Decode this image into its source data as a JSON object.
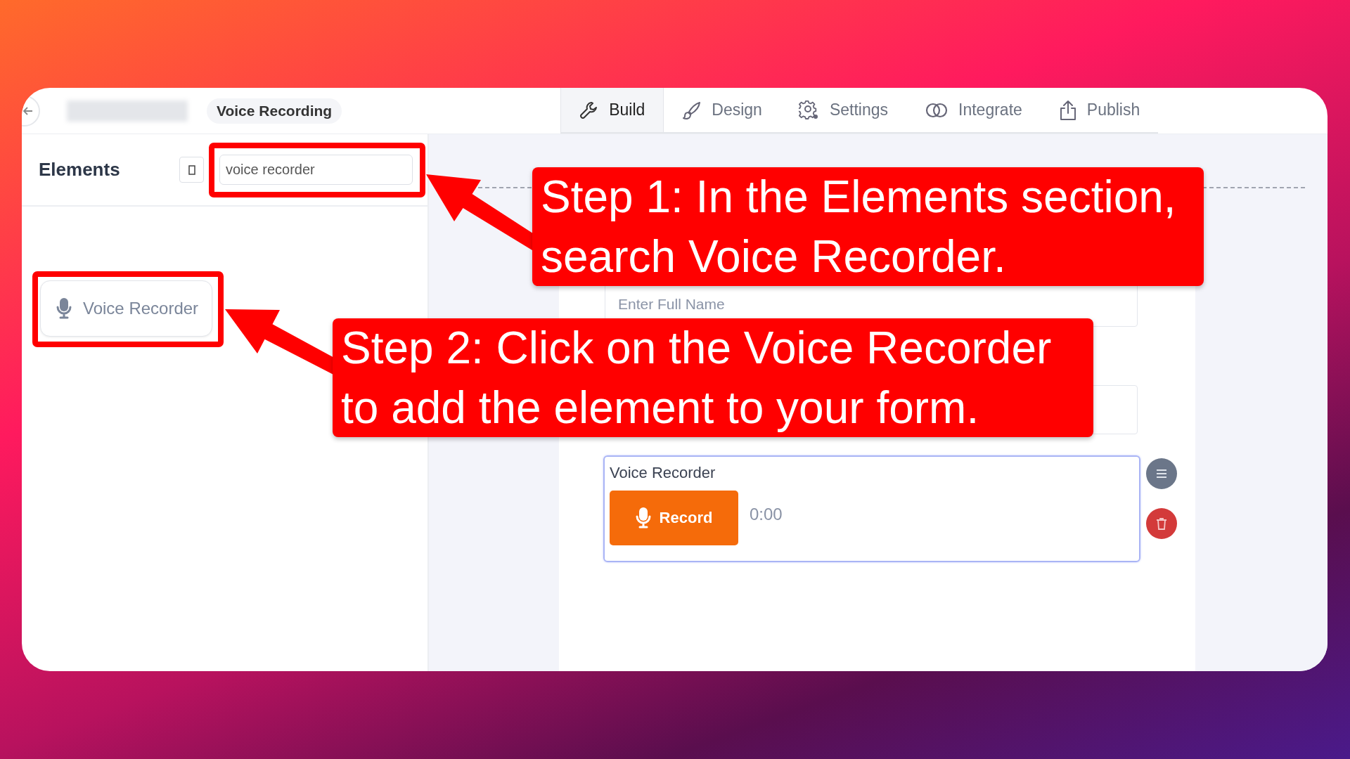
{
  "header": {
    "title": "Voice Recording",
    "tabs": [
      {
        "label": "Build",
        "selected": true
      },
      {
        "label": "Design",
        "selected": false
      },
      {
        "label": "Settings",
        "selected": false
      },
      {
        "label": "Integrate",
        "selected": false
      },
      {
        "label": "Publish",
        "selected": false
      }
    ]
  },
  "elements_panel": {
    "heading": "Elements",
    "search": {
      "value": "voice recorder"
    },
    "results": [
      {
        "label": "Voice Recorder"
      }
    ]
  },
  "form": {
    "fields": [
      {
        "kind": "text",
        "placeholder": "Enter Full Name"
      },
      {
        "kind": "text"
      },
      {
        "kind": "voice_recorder",
        "label": "Voice Recorder",
        "button": "Record",
        "time": "0:00",
        "selected": true
      }
    ]
  },
  "annotations": [
    {
      "text": "Step 1: In the Elements section, search Voice Recorder."
    },
    {
      "text": "Step 2: Click on the Voice Recorder to add the element to your form."
    }
  ]
}
